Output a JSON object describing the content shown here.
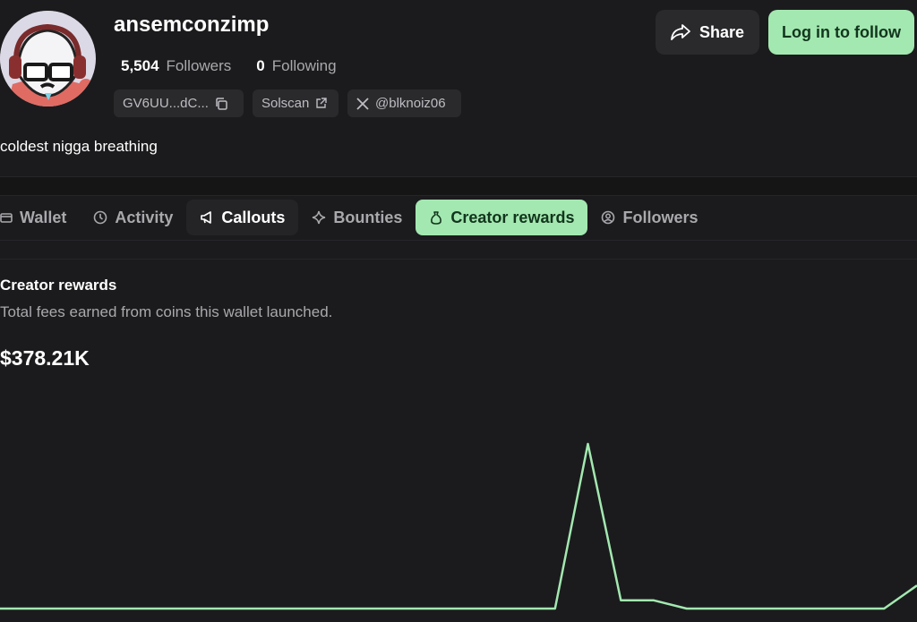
{
  "profile": {
    "username": "ansemconzimp",
    "followers_count": "5,504",
    "followers_label": "Followers",
    "following_count": "0",
    "following_label": "Following",
    "wallet_short": "GV6UU...dC...",
    "solscan_label": "Solscan",
    "x_handle": "@blknoiz06",
    "bio": "coldest nigga breathing"
  },
  "actions": {
    "share_label": "Share",
    "follow_label": "Log in to follow"
  },
  "tabs": [
    {
      "label": "Wallet",
      "icon": "wallet-icon"
    },
    {
      "label": "Activity",
      "icon": "clock-icon"
    },
    {
      "label": "Callouts",
      "icon": "megaphone-icon"
    },
    {
      "label": "Bounties",
      "icon": "sparkle-icon"
    },
    {
      "label": "Creator rewards",
      "icon": "money-bag-icon",
      "active": true
    },
    {
      "label": "Followers",
      "icon": "user-circle-icon"
    }
  ],
  "rewards": {
    "title": "Creator rewards",
    "subtitle": "Total fees earned from coins this wallet launched.",
    "total": "$378.21K",
    "line_color": "#a3e8b0"
  },
  "chart_data": {
    "type": "line",
    "title": "",
    "xlabel": "",
    "ylabel": "",
    "grid": false,
    "legend": "none",
    "x": [
      0,
      1,
      2,
      3,
      4,
      5,
      6,
      7,
      8,
      9,
      10,
      11,
      12,
      13,
      14,
      15,
      16,
      17,
      18,
      19,
      20,
      21,
      22,
      23,
      24,
      25,
      26,
      27,
      28
    ],
    "values": [
      0,
      0,
      0,
      0,
      0,
      0,
      0,
      0,
      0,
      0,
      0,
      0,
      0,
      0,
      0,
      0,
      0,
      0,
      100,
      5,
      5,
      0,
      0,
      0,
      0,
      0,
      0,
      0,
      14
    ],
    "ylim": [
      0,
      100
    ]
  }
}
